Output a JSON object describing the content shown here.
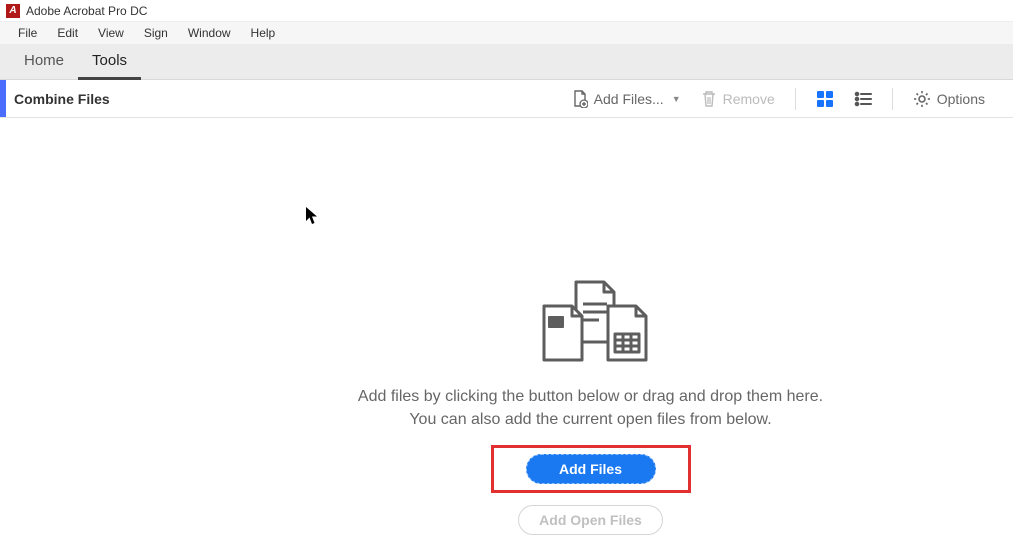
{
  "app": {
    "title": "Adobe Acrobat Pro DC",
    "icon_letter": "A"
  },
  "menubar": {
    "items": [
      "File",
      "Edit",
      "View",
      "Sign",
      "Window",
      "Help"
    ]
  },
  "tabs": {
    "items": [
      "Home",
      "Tools"
    ],
    "active_index": 1
  },
  "toolbar": {
    "title": "Combine Files",
    "add_files_label": "Add Files...",
    "remove_label": "Remove",
    "options_label": "Options"
  },
  "main": {
    "instruction_line1": "Add files by clicking the button below or drag and drop them here.",
    "instruction_line2": "You can also add the current open files from below.",
    "add_files_button": "Add Files",
    "add_open_files_button": "Add Open Files"
  }
}
